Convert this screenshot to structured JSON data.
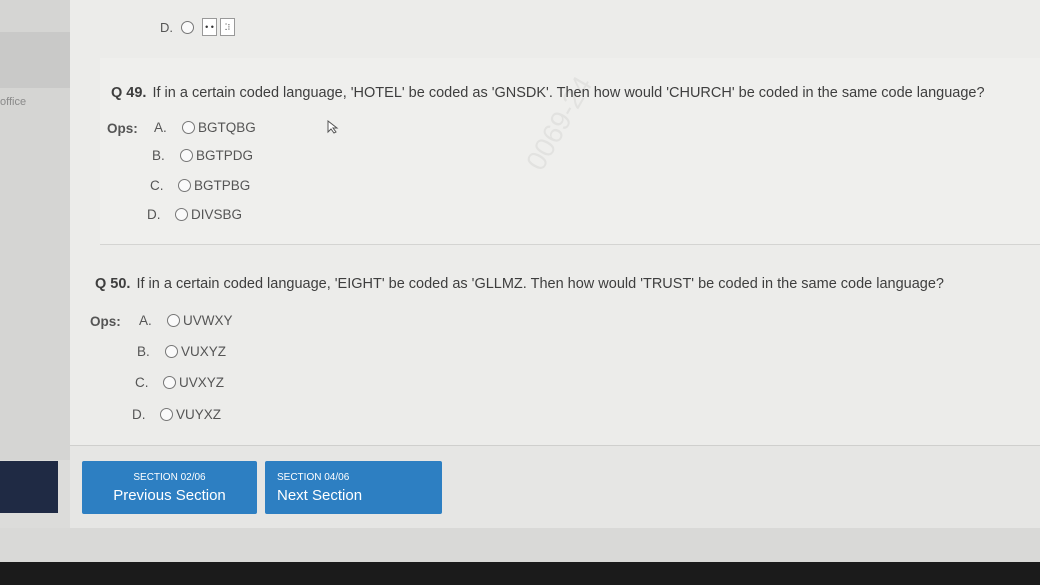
{
  "sidebar": {
    "office_label": "office"
  },
  "previous_question": {
    "option_letter": "D.",
    "dice_faces": [
      "• •",
      "⁚⁝",
      "•"
    ]
  },
  "questions": [
    {
      "number": "Q 49.",
      "text": "If in a certain coded language, 'HOTEL' be coded as 'GNSDK'. Then how would 'CHURCH' be coded in the same code language?",
      "ops_label": "Ops:",
      "options": [
        {
          "letter": "A.",
          "text": "BGTQBG"
        },
        {
          "letter": "B.",
          "text": "BGTPDG"
        },
        {
          "letter": "C.",
          "text": "BGTPBG"
        },
        {
          "letter": "D.",
          "text": "DIVSBG"
        }
      ]
    },
    {
      "number": "Q 50.",
      "text": "If in a certain coded language, 'EIGHT' be coded as 'GLLMZ. Then how would 'TRUST' be coded in the same code language?",
      "ops_label": "Ops:",
      "options": [
        {
          "letter": "A.",
          "text": "UVWXY"
        },
        {
          "letter": "B.",
          "text": "VUXYZ"
        },
        {
          "letter": "C.",
          "text": "UVXYZ"
        },
        {
          "letter": "D.",
          "text": "VUYXZ"
        }
      ]
    }
  ],
  "navigation": {
    "previous": {
      "section": "SECTION 02/06",
      "label": "Previous Section"
    },
    "next": {
      "section": "SECTION 04/06",
      "label": "Next Section"
    }
  },
  "colors": {
    "button": "#2d7fc2",
    "background": "#ececea"
  }
}
